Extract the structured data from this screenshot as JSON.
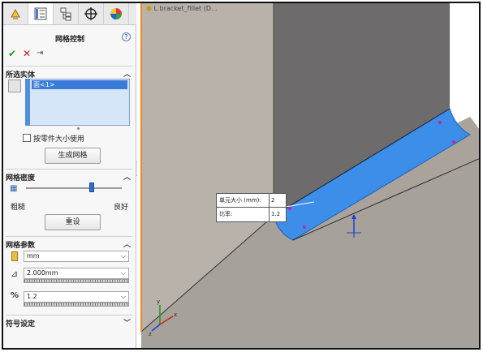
{
  "panel": {
    "title": "网格控制",
    "help": "?",
    "ok": "✔",
    "cancel": "✕",
    "pin": "⇥",
    "tabs": [
      {
        "name": "feature-manager-icon"
      },
      {
        "name": "property-manager-icon"
      },
      {
        "name": "configuration-manager-icon"
      },
      {
        "name": "dimxpert-icon"
      },
      {
        "name": "display-manager-icon"
      }
    ],
    "selected_entities": {
      "header": "所选实体",
      "items": [
        "面<1>"
      ]
    },
    "use_part_size_label": "按零件大小使用",
    "use_part_size_checked": false,
    "generate_mesh_button": "生成网格",
    "mesh_density": {
      "header": "网格密度",
      "coarse": "粗糙",
      "fine": "良好",
      "slider_position": 0.69,
      "reset_button": "重设"
    },
    "mesh_parameters": {
      "header": "网格参数",
      "unit": "mm",
      "element_size": "2.000mm",
      "ratio": "1.2"
    },
    "symbol_settings": {
      "header": "符号设定"
    }
  },
  "viewport": {
    "tree_label": "L bracket_fillet (D...",
    "callout": {
      "size_label": "单元大小 (mm):",
      "size_value": "2",
      "ratio_label": "比率:",
      "ratio_value": "1.2"
    },
    "colors": {
      "highlight_face": "#3d8ee8",
      "edge_highlight": "#f08a1e",
      "face_dark": "#707070",
      "face_light": "#a6a6a6"
    }
  }
}
